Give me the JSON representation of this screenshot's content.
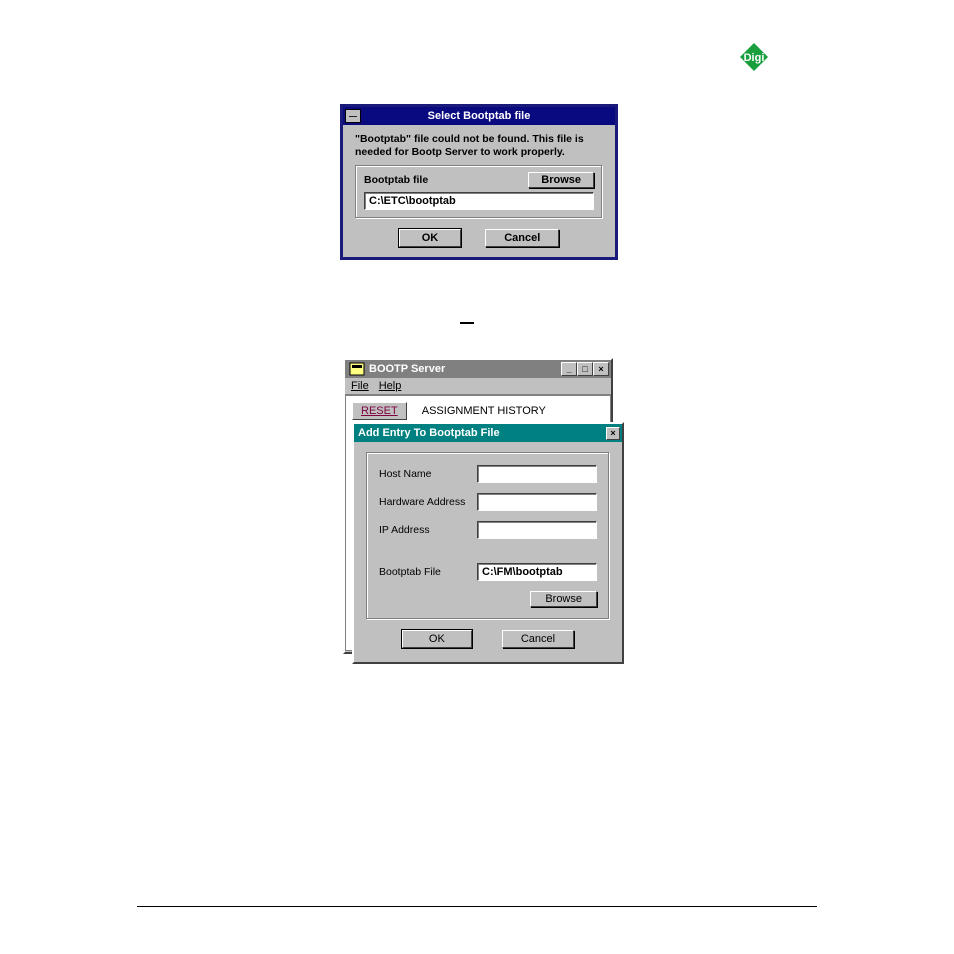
{
  "logo": {
    "text": "Digi"
  },
  "dialog1": {
    "title": "Select Bootptab file",
    "message": "\"Bootptab\" file could not be found. This file is needed for Bootp Server to work properly.",
    "field_label": "Bootptab file",
    "browse_label": "Browse",
    "path_value": "C:\\ETC\\bootptab",
    "ok_label": "OK",
    "cancel_label": "Cancel"
  },
  "server_window": {
    "title": "BOOTP Server",
    "menu_file": "File",
    "menu_help": "Help",
    "reset_label": "RESET",
    "history_label": "ASSIGNMENT HISTORY"
  },
  "addentry": {
    "title": "Add Entry To Bootptab File",
    "host_label": "Host Name",
    "hw_label": "Hardware Address",
    "ip_label": "IP Address",
    "bootptab_label": "Bootptab File",
    "bootptab_value": "C:\\FM\\bootptab",
    "browse_label": "Browse",
    "ok_label": "OK",
    "cancel_label": "Cancel"
  }
}
